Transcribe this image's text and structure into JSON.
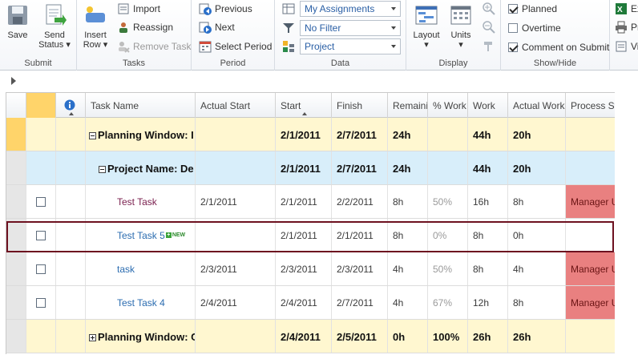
{
  "ribbon": {
    "submit": {
      "label": "Submit",
      "save": "Save",
      "send_status_1": "Send",
      "send_status_2": "Status"
    },
    "tasks": {
      "label": "Tasks",
      "insert_row_1": "Insert",
      "insert_row_2": "Row",
      "import": "Import",
      "reassign": "Reassign",
      "remove_task": "Remove Task"
    },
    "period": {
      "label": "Period",
      "previous": "Previous",
      "next": "Next",
      "select_period": "Select Period"
    },
    "data": {
      "label": "Data",
      "view": "My Assignments",
      "filter": "No Filter",
      "group": "Project"
    },
    "display": {
      "label": "Display",
      "layout": "Layout",
      "units": "Units"
    },
    "showhide": {
      "label": "Show/Hide",
      "planned": "Planned",
      "planned_checked": true,
      "overtime": "Overtime",
      "overtime_checked": false,
      "comment_on_submit": "Comment on Submit",
      "comment_checked": true
    },
    "overflow": {
      "item1": "Ex",
      "item2": "Pr",
      "item3": "Vi"
    }
  },
  "grid": {
    "columns": [
      "Task Name",
      "Actual Start",
      "Start",
      "Finish",
      "Remaining",
      "% Work",
      "Work",
      "Actual Work",
      "Process St"
    ],
    "rows": [
      {
        "type": "window",
        "name": "Planning Window: I",
        "actual_start": "",
        "start": "2/1/2011",
        "finish": "2/7/2011",
        "remaining": "24h",
        "pct_work": "",
        "work": "44h",
        "actual_work": "20h",
        "process_status": ""
      },
      {
        "type": "project",
        "name": "Project Name: De",
        "actual_start": "",
        "start": "2/1/2011",
        "finish": "2/7/2011",
        "remaining": "24h",
        "pct_work": "",
        "work": "44h",
        "actual_work": "20h",
        "process_status": ""
      },
      {
        "type": "task",
        "name": "Test Task",
        "actual_start": "2/1/2011",
        "start": "2/1/2011",
        "finish": "2/2/2011",
        "remaining": "8h",
        "pct_work": "50%",
        "work": "16h",
        "actual_work": "8h",
        "process_status": "Manager U"
      },
      {
        "type": "task",
        "name": "Test Task 5",
        "new_tag": "NEW",
        "actual_start": "",
        "start": "2/1/2011",
        "finish": "2/1/2011",
        "remaining": "8h",
        "pct_work": "0%",
        "work": "8h",
        "actual_work": "0h",
        "process_status": ""
      },
      {
        "type": "task",
        "name": "task",
        "actual_start": "2/3/2011",
        "start": "2/3/2011",
        "finish": "2/3/2011",
        "remaining": "4h",
        "pct_work": "50%",
        "work": "8h",
        "actual_work": "4h",
        "process_status": "Manager U"
      },
      {
        "type": "task",
        "name": "Test Task 4",
        "actual_start": "2/4/2011",
        "start": "2/4/2011",
        "finish": "2/7/2011",
        "remaining": "4h",
        "pct_work": "67%",
        "work": "12h",
        "actual_work": "8h",
        "process_status": "Manager U"
      },
      {
        "type": "window",
        "name": "Planning Window: C",
        "actual_start": "",
        "start": "2/4/2011",
        "finish": "2/5/2011",
        "remaining": "0h",
        "pct_work": "100%",
        "work": "26h",
        "actual_work": "26h",
        "process_status": ""
      }
    ]
  },
  "colors": {
    "window_row": "#fff7d0",
    "project_row": "#d8eefa",
    "process_status_bg": "#e98080",
    "highlight_border": "#6d1120"
  }
}
